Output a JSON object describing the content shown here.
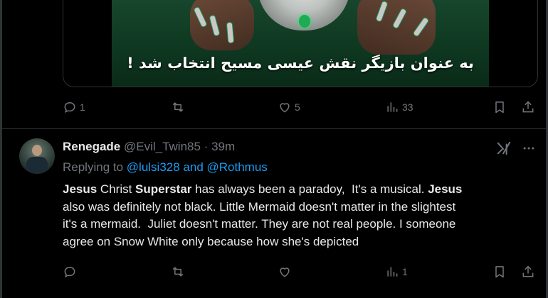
{
  "first_tweet": {
    "media_caption": "به عنوان بازیگر نقش عیسی مسیح انتخاب شد !",
    "actions": {
      "reply_count": "1",
      "repost_count": "",
      "like_count": "5",
      "view_count": "33"
    }
  },
  "reply_tweet": {
    "display_name": "Renegade",
    "handle": "@Evil_Twin85",
    "separator": "·",
    "time": "39m",
    "replying_to_prefix": "Replying to ",
    "replying_to_users": "@lulsi328 and @Rothmus",
    "body_segments": [
      {
        "text": "Jesus",
        "bold": true
      },
      {
        "text": " Christ ",
        "bold": false
      },
      {
        "text": "Superstar",
        "bold": true
      },
      {
        "text": " has always been a paradoy,  It's a musical. ",
        "bold": false
      },
      {
        "text": "Jesus",
        "bold": true
      },
      {
        "text": "\nalso was definitely not black. Little Mermaid doesn't matter in the slightest\nit's a mermaid.  Juliet doesn't matter. They are not real people. I someone\nagree on Snow White only because how she's depicted",
        "bold": false
      }
    ],
    "actions": {
      "reply_count": "",
      "repost_count": "",
      "like_count": "",
      "view_count": "1"
    }
  },
  "colors": {
    "background": "#000000",
    "text": "#e7e9ea",
    "muted": "#71767b",
    "link": "#1d9bf0",
    "border": "#2f3336"
  }
}
